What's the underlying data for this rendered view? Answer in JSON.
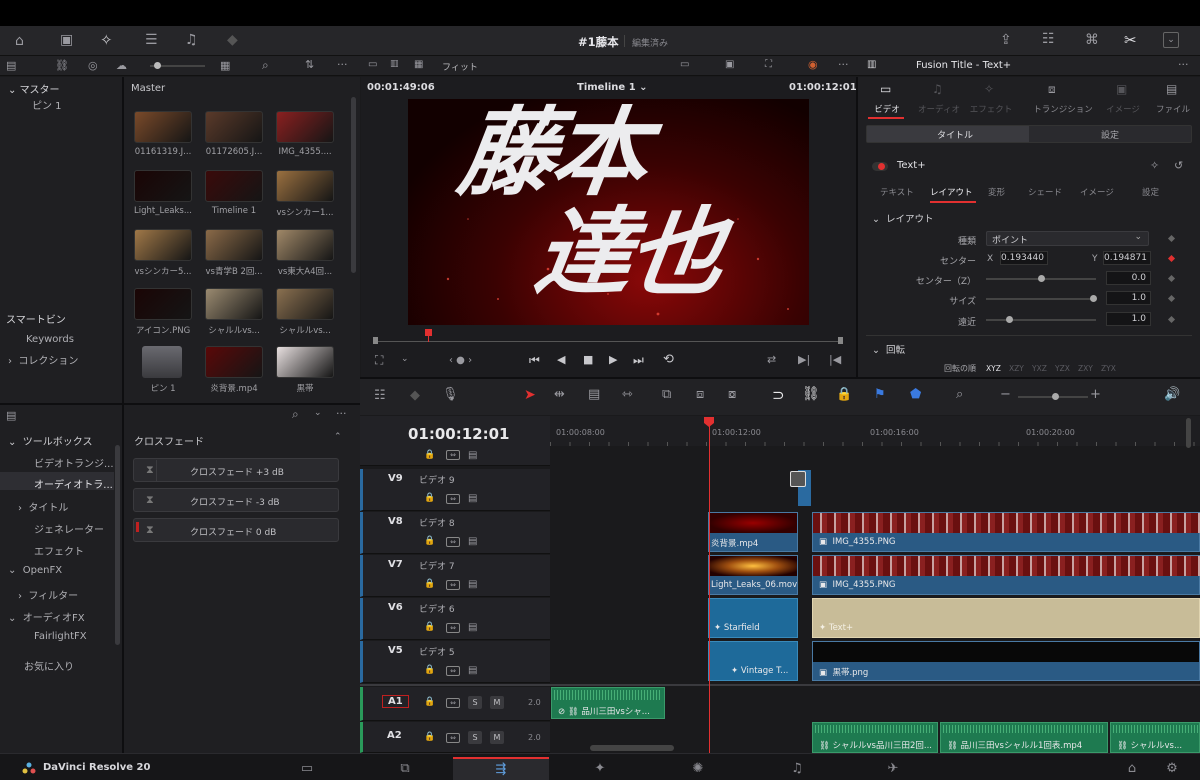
{
  "project": {
    "title": "#1藤本",
    "status": "編集済み"
  },
  "media_pool": {
    "bin_label": "マスター",
    "bin_child": "ピン 1",
    "master_label": "Master",
    "smart_bins": "スマートビン",
    "keywords": "Keywords",
    "collections": "コレクション",
    "clips": [
      {
        "name": "01161319.J...",
        "color": "#7a4a2a"
      },
      {
        "name": "01172605.J...",
        "color": "#5a3a2a"
      },
      {
        "name": "IMG_4355....",
        "color": "#8a2020"
      },
      {
        "name": "Light_Leaks...",
        "color": "#1a0505"
      },
      {
        "name": "Timeline 1",
        "color": "#3a0a0a"
      },
      {
        "name": "vsシンカー1...",
        "color": "#9a7040"
      },
      {
        "name": "vsシンカー5...",
        "color": "#a07848"
      },
      {
        "name": "vs青学B 2回...",
        "color": "#8a6a48"
      },
      {
        "name": "vs東大A4回...",
        "color": "#a08868"
      },
      {
        "name": "アイコン.PNG",
        "color": "#1a0505"
      },
      {
        "name": "シャルルvs...",
        "color": "#9a8a70"
      },
      {
        "name": "シャルルvs...",
        "color": "#8a7050"
      },
      {
        "name": "ピン 1",
        "color": "#4a4a4e"
      },
      {
        "name": "炎背景.mp4",
        "color": "#5a0808"
      },
      {
        "name": "黒帯",
        "color": "#e8e0e0"
      }
    ]
  },
  "effects": {
    "toolbox": "ツールボックス",
    "video_transitions": "ビデオトランジ...",
    "audio_transitions": "オーディオトラ...",
    "titles": "タイトル",
    "generators": "ジェネレーター",
    "effects": "エフェクト",
    "openfx": "OpenFX",
    "filters": "フィルター",
    "audio_fx": "オーディオFX",
    "fairlight": "FairlightFX",
    "favorites": "お気に入り",
    "section": "クロスフェード",
    "items": [
      "クロスフェード +3 dB",
      "クロスフェード -3 dB",
      "クロスフェード 0 dB"
    ]
  },
  "viewer": {
    "fit": "フィット",
    "timecode_left": "00:01:49:06",
    "timeline_name": "Timeline 1",
    "timecode_right": "01:00:12:01",
    "title_line1": "藤本",
    "title_line2": "達也"
  },
  "inspector": {
    "header": "Fusion Title - Text+",
    "tabs": [
      "ビデオ",
      "オーディオ",
      "エフェクト",
      "トランジション",
      "イメージ",
      "ファイル"
    ],
    "subtabs": [
      "タイトル",
      "設定"
    ],
    "node": "Text+",
    "node_tabs": [
      "テキスト",
      "レイアウト",
      "変形",
      "シェード",
      "イメージ",
      "設定"
    ],
    "section_layout": "レイアウト",
    "type_label": "種類",
    "type_value": "ポイント",
    "center_label": "センター",
    "x_label": "X",
    "x_value": "0.193440",
    "y_label": "Y",
    "y_value": "0.194871",
    "centerz_label": "センター（Z）",
    "centerz_value": "0.0",
    "size_label": "サイズ",
    "size_value": "1.0",
    "perspective_label": "遠近",
    "perspective_value": "1.0",
    "section_rotation": "回転",
    "rotation_order_label": "回転の順",
    "rotation_orders": [
      "XYZ",
      "XZY",
      "YXZ",
      "YZX",
      "ZXY",
      "ZYX"
    ]
  },
  "timeline": {
    "timecode": "01:00:12:01",
    "ruler": [
      "01:00:08:00",
      "01:00:12:00",
      "01:00:16:00",
      "01:00:20:00"
    ],
    "tracks": [
      {
        "id": "V9",
        "name": "ビデオ 9"
      },
      {
        "id": "V8",
        "name": "ビデオ 8"
      },
      {
        "id": "V7",
        "name": "ビデオ 7"
      },
      {
        "id": "V6",
        "name": "ビデオ 6"
      },
      {
        "id": "V5",
        "name": "ビデオ 5"
      },
      {
        "id": "A1",
        "name": "2.0"
      },
      {
        "id": "A2",
        "name": "2.0"
      }
    ],
    "clips": {
      "v8a": "炎背景.mp4",
      "v8b": "IMG_4355.PNG",
      "v7a": "Light_Leaks_06.mov",
      "v7b": "IMG_4355.PNG",
      "v6a": "Starfield",
      "v6b": "Text+",
      "v5a": "Vintage T...",
      "v5b": "黒帯.png",
      "a1": "品川三田vsシャ...",
      "a2a": "シャルルvs品川三田2回...",
      "a2b": "品川三田vsシャルル1回表.mp4",
      "a2c": "シャルルvs..."
    },
    "solo": "S",
    "mute": "M"
  },
  "app": {
    "name": "DaVinci Resolve 20"
  }
}
